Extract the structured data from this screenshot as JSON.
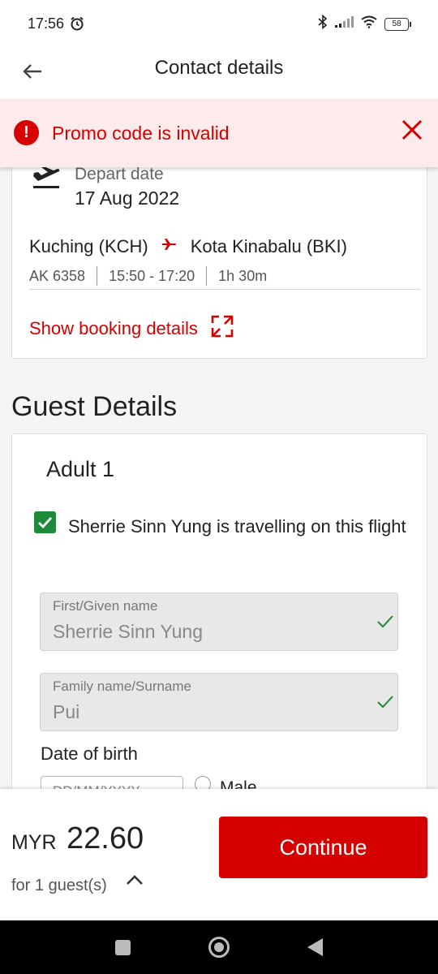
{
  "status_bar": {
    "time": "17:56",
    "battery": "58"
  },
  "header": {
    "title": "Contact details"
  },
  "alert": {
    "message": "Promo code is invalid",
    "icon": "!"
  },
  "flight": {
    "depart_label": "Depart date",
    "depart_date": "17 Aug 2022",
    "origin": "Kuching (KCH)",
    "destination": "Kota Kinabalu (BKI)",
    "flight_number": "AK 6358",
    "time_range": "15:50 - 17:20",
    "duration": "1h 30m",
    "show_booking_label": "Show booking details"
  },
  "guest": {
    "heading": "Guest Details",
    "adult_label": "Adult 1",
    "travelling_text": "Sherrie Sinn Yung is travelling on this flight",
    "first_name_label": "First/Given name",
    "first_name_value": "Sherrie Sinn Yung",
    "family_name_label": "Family name/Surname",
    "family_name_value": "Pui",
    "dob_label": "Date of birth",
    "dob_placeholder": "DD/MM/YYYY",
    "gender_option": "Male"
  },
  "footer": {
    "currency": "MYR",
    "amount": "22.60",
    "guest_count": "for 1 guest(s)",
    "continue_label": "Continue"
  },
  "colors": {
    "brand_red": "#d50000",
    "check_green": "#1e8a3a",
    "alert_bg": "#fcebea"
  }
}
